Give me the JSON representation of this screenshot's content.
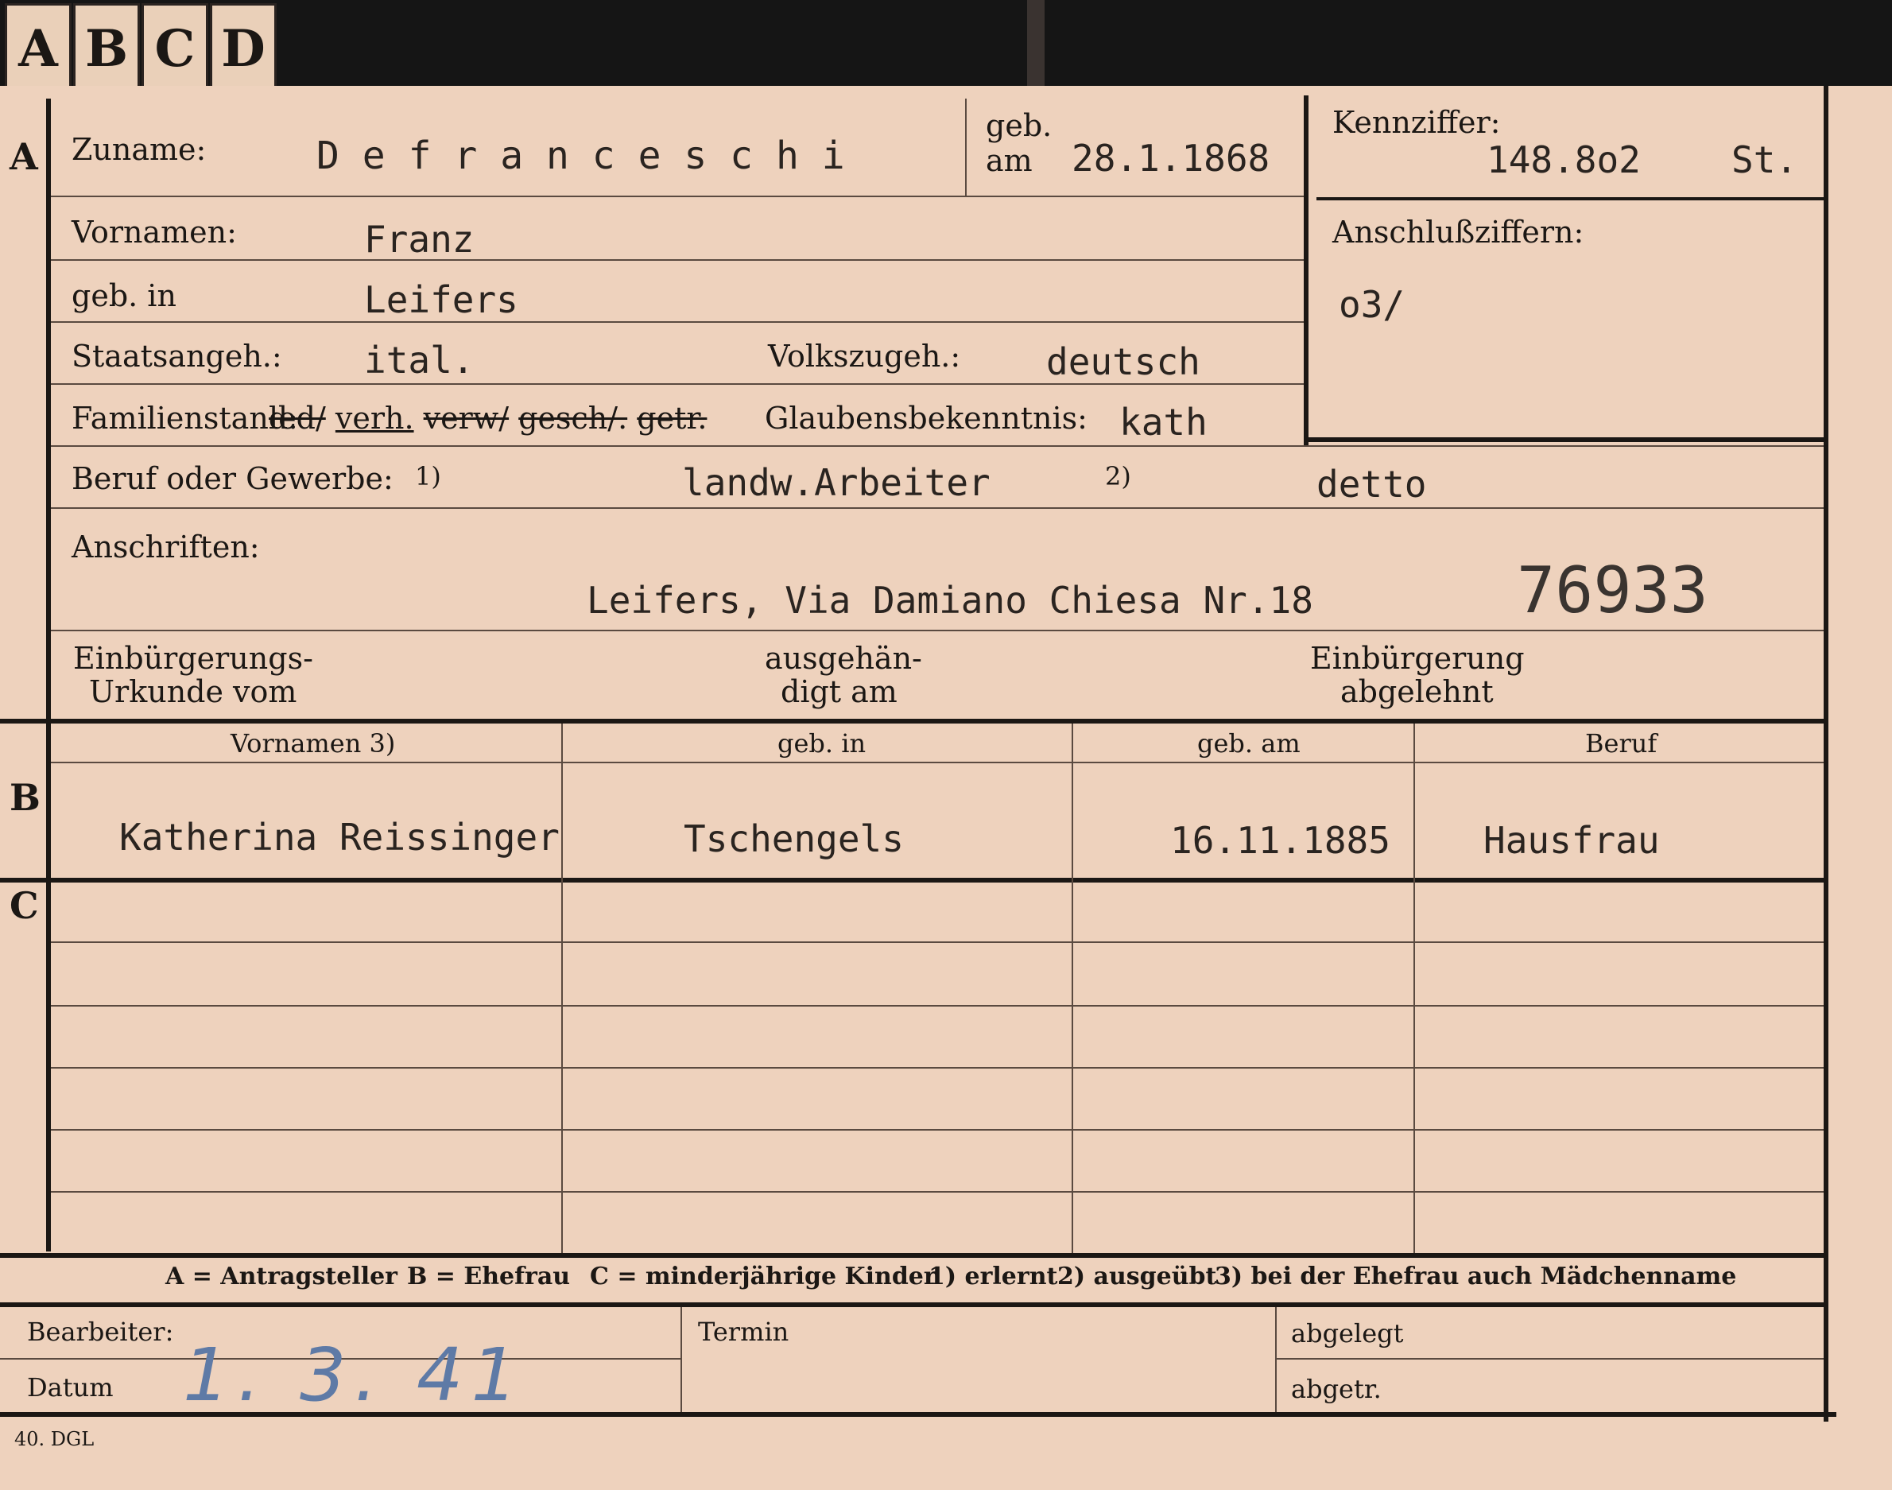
{
  "tabs": [
    "A",
    "B",
    "C",
    "D"
  ],
  "sections": {
    "a": "A",
    "b": "B",
    "c": "C"
  },
  "applicant": {
    "surname_label": "Zuname:",
    "surname": "D e f r a n c e s c h i",
    "born_on_label_1": "geb.",
    "born_on_label_2": "am",
    "born_on": "28.1.1868",
    "id_label": "Kennziffer:",
    "id_value": "148.8o2",
    "id_suffix": "St.",
    "linked_label": "Anschlußziffern:",
    "linked_value": "o3/",
    "firstnames_label": "Vornamen:",
    "firstnames": "Franz",
    "birthplace_label": "geb. in",
    "birthplace": "Leifers",
    "citizenship_label": "Staatsangeh.:",
    "citizenship": "ital.",
    "ethnicity_label": "Volkszugeh.:",
    "ethnicity": "deutsch",
    "marital_label": "Familienstand:",
    "marital_options": [
      "led/",
      "verh.",
      "verw/",
      "gesch/.",
      "getr."
    ],
    "religion_label": "Glaubensbekenntnis:",
    "religion": "kath",
    "profession_label": "Beruf oder Gewerbe:",
    "profession_mark_1": "1)",
    "profession_learned": "landw.Arbeiter",
    "profession_mark_2": "2)",
    "profession_practised": "detto",
    "address_label": "Anschriften:",
    "address": "Leifers, Via Damiano  Chiesa  Nr.18",
    "stamp_number": "76933",
    "naturalization_doc_label_1": "Einbürgerungs-",
    "naturalization_doc_label_2": "Urkunde vom",
    "handed_label_1": "ausgehän-",
    "handed_label_2": "digt am",
    "rejected_label_1": "Einbürgerung",
    "rejected_label_2": "abgelehnt"
  },
  "spouse_table": {
    "headers": [
      "Vornamen 3)",
      "geb. in",
      "geb. am",
      "Beruf"
    ],
    "row": [
      "Katherina Reissinger",
      "Tschengels",
      "16.11.1885",
      "Hausfrau"
    ]
  },
  "legend": {
    "a": "A = Antragsteller",
    "b": "B = Ehefrau",
    "c": "C = minderjährige Kinder",
    "n1": "1) erlernt",
    "n2": "2) ausgeübt",
    "n3": "3) bei der Ehefrau auch Mädchenname"
  },
  "footer": {
    "clerk_label": "Bearbeiter:",
    "date_label": "Datum",
    "date_value": "1. 3. 41",
    "deadline_label": "Termin",
    "filed_label": "abgelegt",
    "sent_label": "abgetr.",
    "form_code": "40. DGL"
  }
}
